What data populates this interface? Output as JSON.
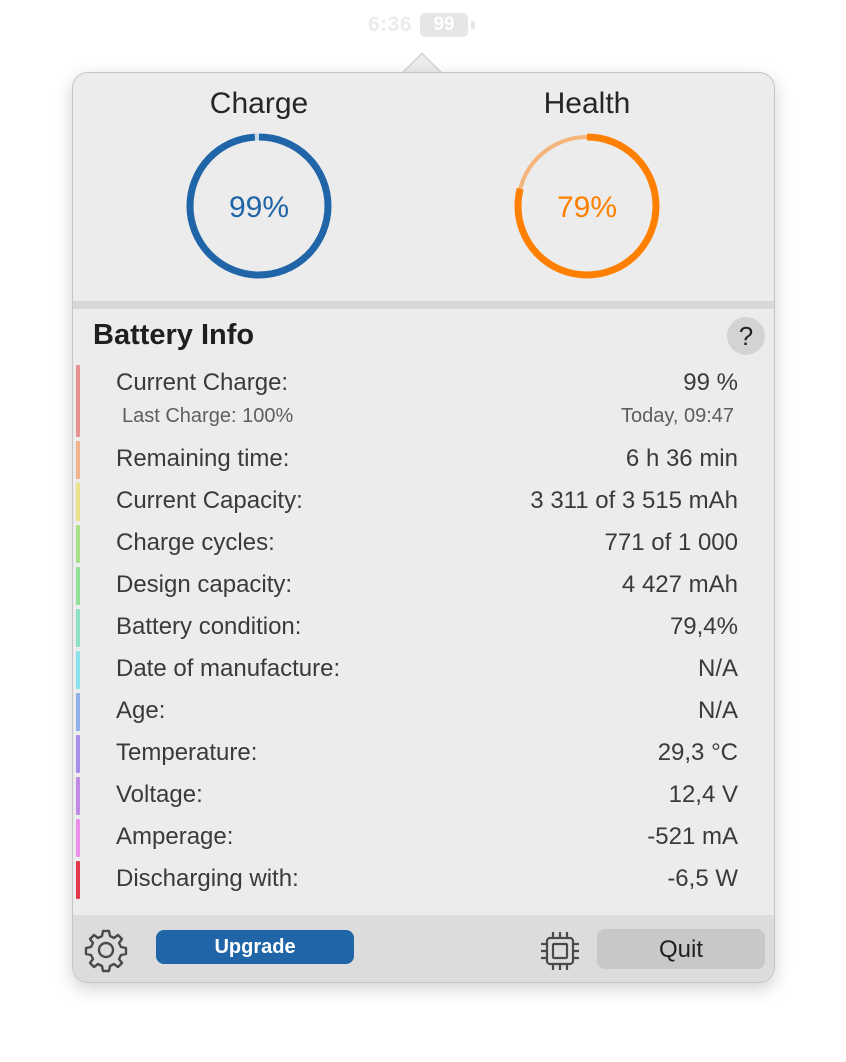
{
  "menubar": {
    "time": "6:36",
    "battery_level": "99"
  },
  "gauges": {
    "charge": {
      "title": "Charge",
      "value_text": "99%",
      "fraction": 0.99,
      "color": "#1f65a8",
      "track_color": "#c4d7ea"
    },
    "health": {
      "title": "Health",
      "value_text": "79%",
      "fraction": 0.79,
      "color": "#ff8000",
      "track_color": "#f5b47a"
    }
  },
  "battery_info": {
    "title": "Battery Info",
    "help_label": "?",
    "rows": [
      {
        "label": "Current Charge:",
        "value": "99 %",
        "sublabel": "Last Charge: 100%",
        "subvalue": "Today, 09:47",
        "color": "#e89090"
      },
      {
        "label": "Remaining time:",
        "value": "6 h 36 min",
        "color": "#f0b48a"
      },
      {
        "label": "Current Capacity:",
        "value": "3 311 of 3 515 mAh",
        "color": "#ece28a"
      },
      {
        "label": "Charge cycles:",
        "value": "771 of 1 000",
        "color": "#a8e08a"
      },
      {
        "label": "Design capacity:",
        "value": "4 427 mAh",
        "color": "#90e098"
      },
      {
        "label": "Battery condition:",
        "value": "79,4%",
        "color": "#8ee0c0"
      },
      {
        "label": "Date of manufacture:",
        "value": "N/A",
        "color": "#8ae2ec"
      },
      {
        "label": "Age:",
        "value": "N/A",
        "color": "#90b0ec"
      },
      {
        "label": "Temperature:",
        "value": "29,3 °C",
        "color": "#a890ea"
      },
      {
        "label": "Voltage:",
        "value": "12,4 V",
        "color": "#c08ae6"
      },
      {
        "label": "Amperage:",
        "value": "-521 mA",
        "color": "#ea90e8"
      },
      {
        "label": "Discharging with:",
        "value": "-6,5 W",
        "color": "#e0384a"
      }
    ]
  },
  "footer": {
    "settings_icon": "gear-icon",
    "upgrade_label": "Upgrade",
    "chip_icon": "cpu-chip-icon",
    "quit_label": "Quit"
  }
}
